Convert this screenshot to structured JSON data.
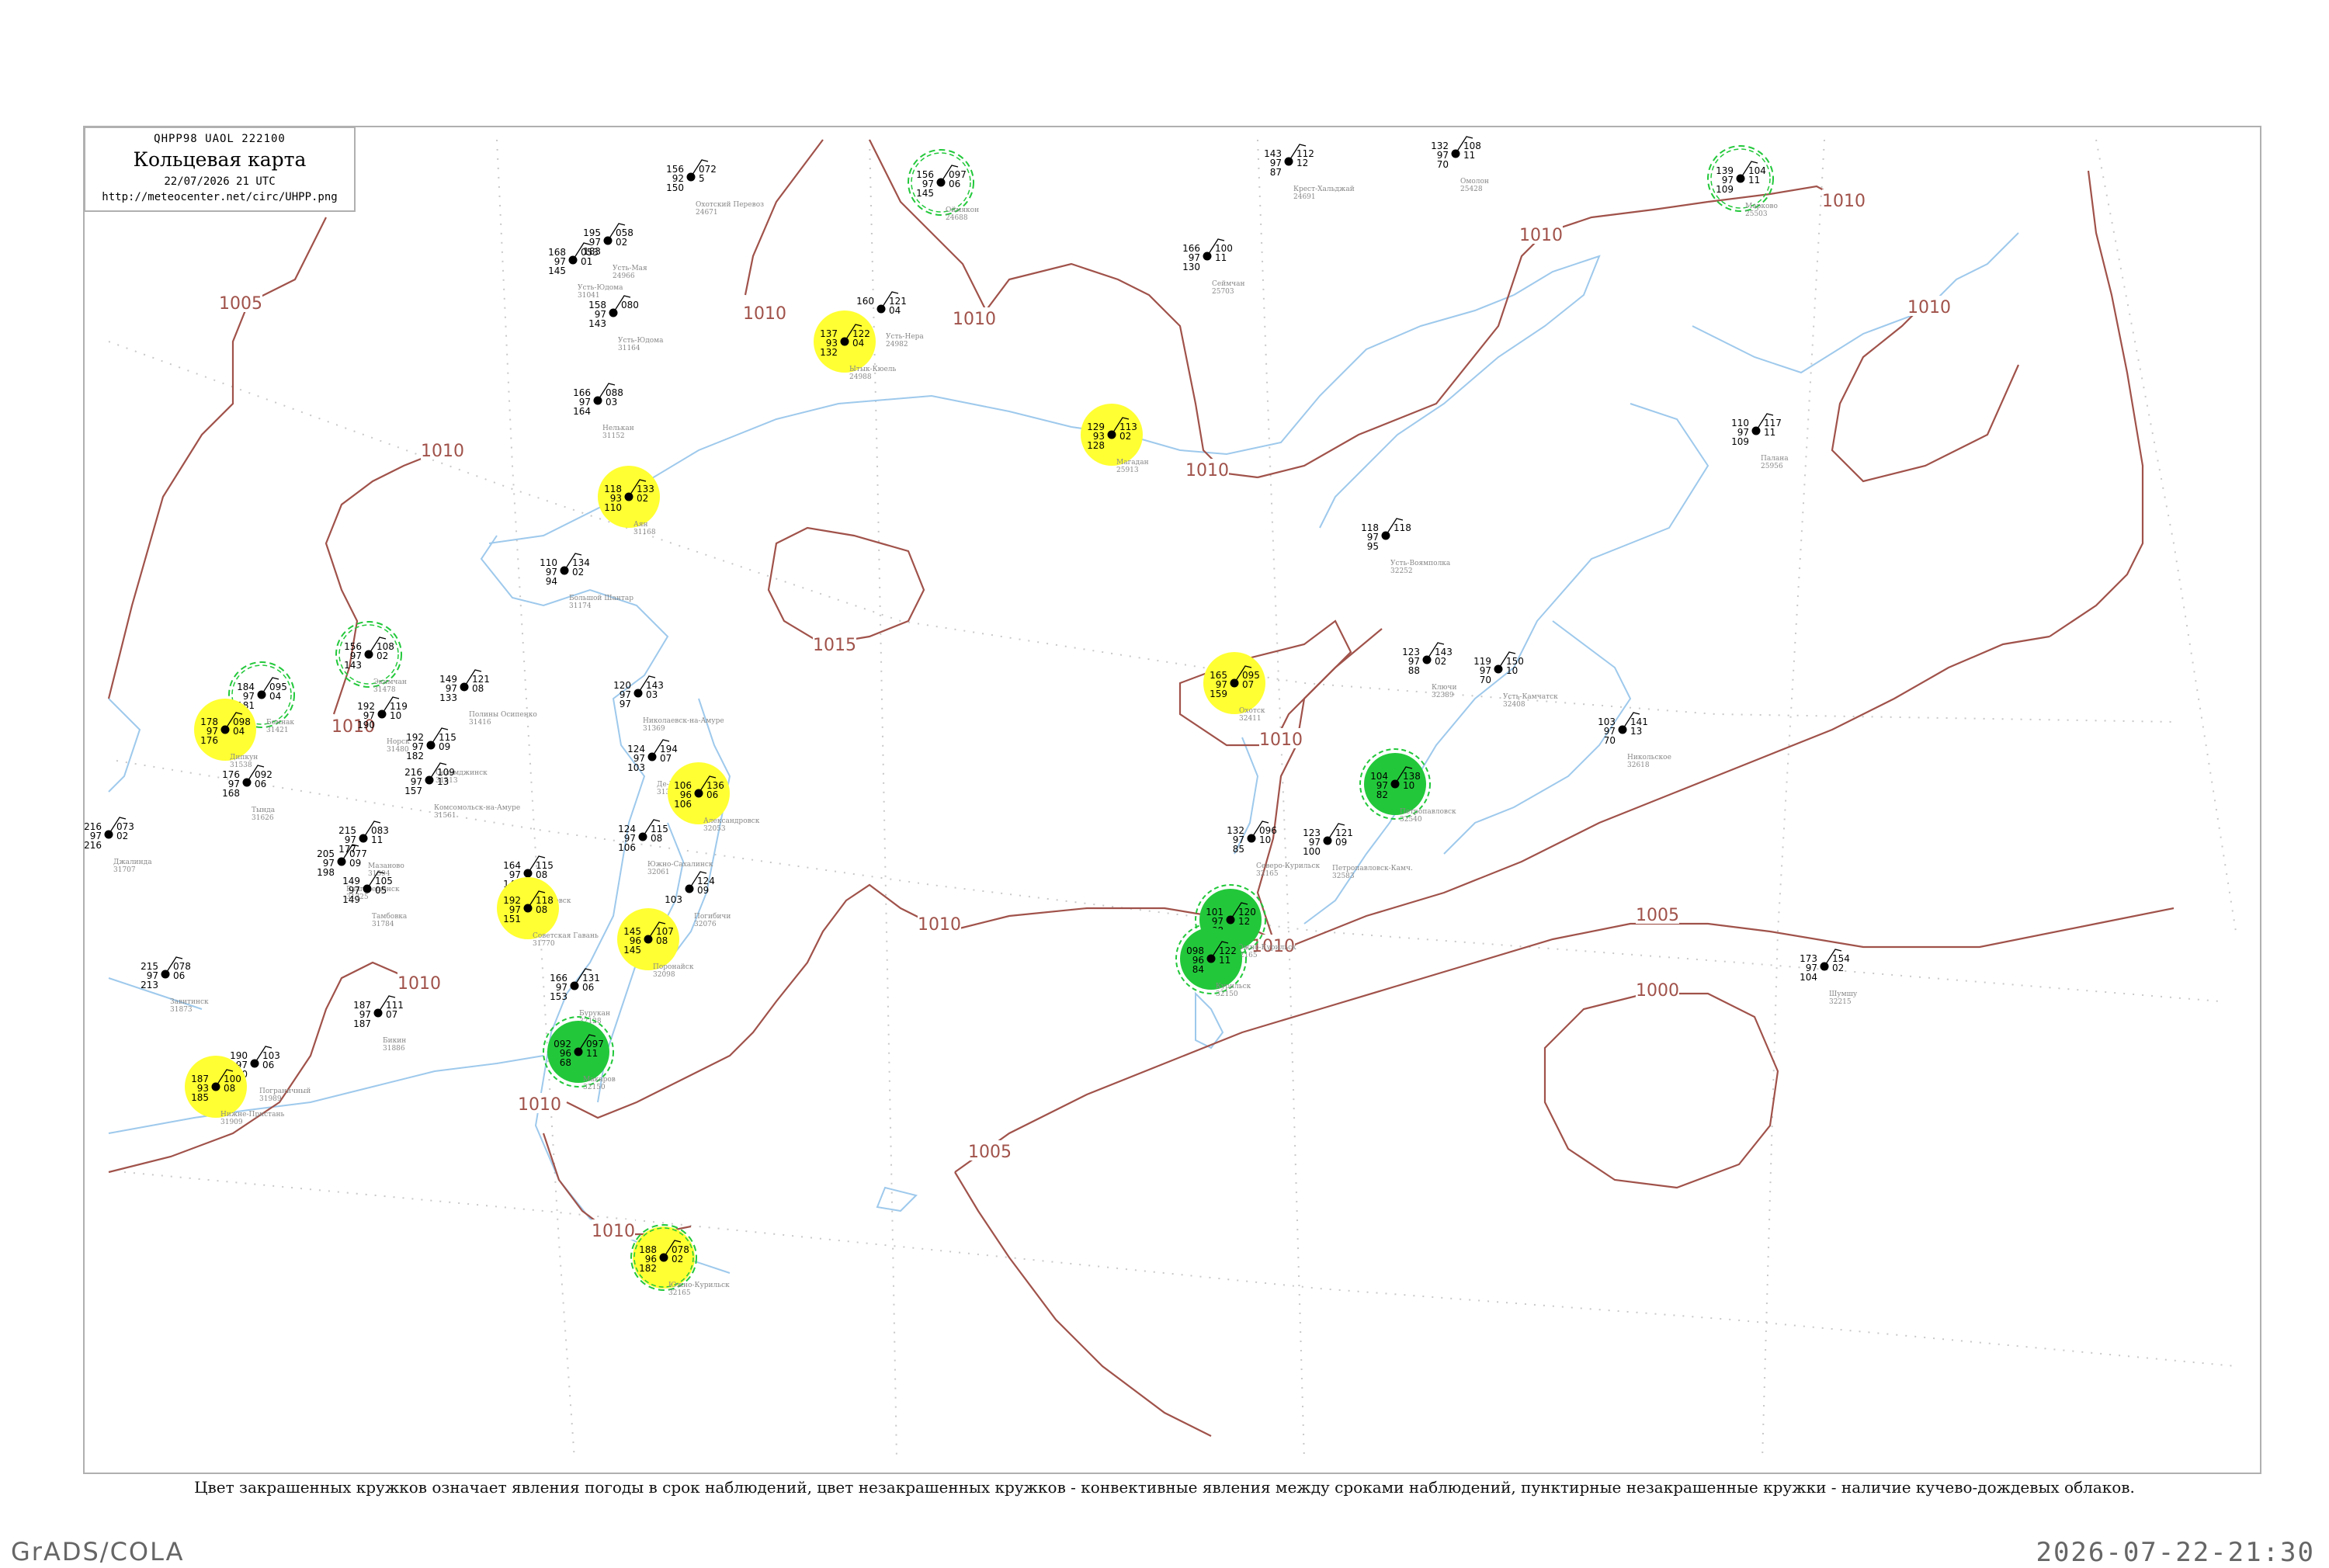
{
  "header": {
    "code_line": "QHPP98  UAOL  222100",
    "title": "Кольцевая карта",
    "time": "22/07/2026 21 UTC",
    "url": "http://meteocenter.net/circ/UHPP.png"
  },
  "caption": "Цвет закрашенных кружков означает явления погоды в срок наблюдений, цвет незакрашенных кружков - конвективные явления между сроками наблюдений, пунктирные незакрашенные кружки - наличие кучево-дождевых облаков.",
  "footer": {
    "left": "GrADS/COLA",
    "right": "2026-07-22-21:30"
  },
  "colors": {
    "isobar": "#a0524a",
    "coast": "#9ec9ec",
    "frame": "#b0b0b0",
    "grid": "#c8c8c8",
    "highlight_yellow": "#ffff33",
    "highlight_green": "#22c83a",
    "dashed_green": "#22c83a"
  },
  "isobar_labels": [
    {
      "text": "1005",
      "pos": [
        310,
        390
      ]
    },
    {
      "text": "1010",
      "pos": [
        570,
        580
      ]
    },
    {
      "text": "1010",
      "pos": [
        985,
        403
      ]
    },
    {
      "text": "1010",
      "pos": [
        1255,
        410
      ]
    },
    {
      "text": "1010",
      "pos": [
        1555,
        605
      ]
    },
    {
      "text": "1010",
      "pos": [
        1985,
        302
      ]
    },
    {
      "text": "1010",
      "pos": [
        2375,
        258
      ]
    },
    {
      "text": "1010",
      "pos": [
        2485,
        395
      ]
    },
    {
      "text": "1015",
      "pos": [
        1075,
        830
      ]
    },
    {
      "text": "1010",
      "pos": [
        1650,
        952
      ]
    },
    {
      "text": "1010",
      "pos": [
        1210,
        1190
      ]
    },
    {
      "text": "1010",
      "pos": [
        1640,
        1218
      ]
    },
    {
      "text": "1005",
      "pos": [
        2135,
        1178
      ]
    },
    {
      "text": "1000",
      "pos": [
        2135,
        1275
      ]
    },
    {
      "text": "1005",
      "pos": [
        1275,
        1483
      ]
    },
    {
      "text": "1010",
      "pos": [
        695,
        1422
      ]
    },
    {
      "text": "1010",
      "pos": [
        540,
        1266
      ]
    },
    {
      "text": "1010",
      "pos": [
        790,
        1585
      ]
    },
    {
      "text": "1010",
      "pos": [
        455,
        935
      ]
    }
  ],
  "stations": [
    {
      "t": "156",
      "td": "92",
      "p": "072",
      "v": "150",
      "n": "5",
      "id": "24671",
      "name": "Охотский Перевоз",
      "pos": [
        890,
        228
      ],
      "hl": "none"
    },
    {
      "t": "156",
      "td": "97",
      "p": "097",
      "v": "145",
      "n": "06",
      "id": "24688",
      "name": "Оймякон",
      "pos": [
        1212,
        235
      ],
      "hl": "dashed"
    },
    {
      "t": "143",
      "td": "97",
      "p": "112",
      "v": "87",
      "n": "12",
      "id": "24691",
      "name": "Крест-Хальджай",
      "pos": [
        1660,
        208
      ],
      "hl": "none"
    },
    {
      "t": "132",
      "td": "97",
      "p": "108",
      "v": "70",
      "n": "11",
      "id": "25428",
      "name": "Омолон",
      "pos": [
        1875,
        198
      ],
      "hl": "none"
    },
    {
      "t": "139",
      "td": "97",
      "p": "104",
      "v": "109",
      "n": "11",
      "id": "25503",
      "name": "Марково",
      "pos": [
        2242,
        230
      ],
      "hl": "dashed"
    },
    {
      "t": "168",
      "td": "97",
      "p": "053",
      "v": "145",
      "n": "01",
      "id": "31041",
      "name": "Усть-Юдома",
      "pos": [
        738,
        335
      ],
      "hl": "none"
    },
    {
      "t": "195",
      "td": "97",
      "p": "058",
      "v": "183",
      "n": "02",
      "id": "24966",
      "name": "Усть-Мая",
      "pos": [
        783,
        310
      ],
      "hl": "none"
    },
    {
      "t": "166",
      "td": "97",
      "p": "100",
      "v": "130",
      "n": "11",
      "id": "25703",
      "name": "Сеймчан",
      "pos": [
        1555,
        330
      ],
      "hl": "none"
    },
    {
      "t": "158",
      "td": "97",
      "p": "080",
      "v": "143",
      "n": "",
      "id": "31164",
      "name": "Усть-Юдома",
      "pos": [
        790,
        403
      ],
      "hl": "none"
    },
    {
      "t": "137",
      "td": "93",
      "p": "122",
      "v": "132",
      "n": "04",
      "id": "24988",
      "name": "Ытык-Кюель",
      "pos": [
        1088,
        440
      ],
      "hl": "yellow"
    },
    {
      "t": "160",
      "td": "",
      "p": "121",
      "v": "",
      "n": "04",
      "id": "24982",
      "name": "Усть-Нера",
      "pos": [
        1135,
        398
      ],
      "hl": "none"
    },
    {
      "t": "166",
      "td": "97",
      "p": "088",
      "v": "164",
      "n": "03",
      "id": "31152",
      "name": "Нелькан",
      "pos": [
        770,
        516
      ],
      "hl": "none"
    },
    {
      "t": "129",
      "td": "93",
      "p": "113",
      "v": "128",
      "n": "02",
      "id": "25913",
      "name": "Магадан",
      "pos": [
        1432,
        560
      ],
      "hl": "yellow"
    },
    {
      "t": "110",
      "td": "97",
      "p": "117",
      "v": "109",
      "n": "11",
      "id": "25956",
      "name": "Палана",
      "pos": [
        2262,
        555
      ],
      "hl": "none"
    },
    {
      "t": "118",
      "td": "93",
      "p": "133",
      "v": "110",
      "n": "02",
      "id": "31168",
      "name": "Аян",
      "pos": [
        810,
        640
      ],
      "hl": "yellow"
    },
    {
      "t": "110",
      "td": "97",
      "p": "134",
      "v": "94",
      "n": "02",
      "id": "31174",
      "name": "Большой Шантар",
      "pos": [
        727,
        735
      ],
      "hl": "none"
    },
    {
      "t": "118",
      "td": "97",
      "p": "118",
      "v": "95",
      "n": "",
      "id": "32252",
      "name": "Усть-Воямполка",
      "pos": [
        1785,
        690
      ],
      "hl": "none"
    },
    {
      "t": "156",
      "td": "97",
      "p": "108",
      "v": "143",
      "n": "02",
      "id": "31478",
      "name": "Экимчан",
      "pos": [
        475,
        843
      ],
      "hl": "dashed"
    },
    {
      "t": "184",
      "td": "97",
      "p": "095",
      "v": "181",
      "n": "04",
      "id": "31421",
      "name": "Бомнак",
      "pos": [
        337,
        895
      ],
      "hl": "dashed"
    },
    {
      "t": "149",
      "td": "97",
      "p": "121",
      "v": "133",
      "n": "08",
      "id": "31416",
      "name": "Полины Осипенко",
      "pos": [
        598,
        885
      ],
      "hl": "none"
    },
    {
      "t": "120",
      "td": "97",
      "p": "143",
      "v": "97",
      "n": "03",
      "id": "31369",
      "name": "Николаевск-на-Амуре",
      "pos": [
        822,
        893
      ],
      "hl": "none"
    },
    {
      "t": "123",
      "td": "97",
      "p": "143",
      "v": "88",
      "n": "02",
      "id": "32389",
      "name": "Ключи",
      "pos": [
        1838,
        850
      ],
      "hl": "none"
    },
    {
      "t": "119",
      "td": "97",
      "p": "150",
      "v": "70",
      "n": "10",
      "id": "32408",
      "name": "Усть-Камчатск",
      "pos": [
        1930,
        862
      ],
      "hl": "none"
    },
    {
      "t": "165",
      "td": "97",
      "p": "095",
      "v": "159",
      "n": "07",
      "id": "32411",
      "name": "Охотск",
      "pos": [
        1590,
        880
      ],
      "hl": "yellow"
    },
    {
      "t": "192",
      "td": "97",
      "p": "119",
      "v": "190",
      "n": "10",
      "id": "31480",
      "name": "Норск",
      "pos": [
        492,
        920
      ],
      "hl": "none"
    },
    {
      "t": "178",
      "td": "97",
      "p": "098",
      "v": "176",
      "n": "04",
      "id": "31538",
      "name": "Дипкун",
      "pos": [
        290,
        940
      ],
      "hl": "yellow"
    },
    {
      "t": "192",
      "td": "97",
      "p": "115",
      "v": "182",
      "n": "09",
      "id": "31513",
      "name": "Селемджинск",
      "pos": [
        555,
        960
      ],
      "hl": "none"
    },
    {
      "t": "124",
      "td": "97",
      "p": "194",
      "v": "103",
      "n": "07",
      "id": "31374",
      "name": "Де-Кастри",
      "pos": [
        840,
        975
      ],
      "hl": "none"
    },
    {
      "t": "103",
      "td": "97",
      "p": "141",
      "v": "70",
      "n": "13",
      "id": "32618",
      "name": "Никольское",
      "pos": [
        2090,
        940
      ],
      "hl": "none"
    },
    {
      "t": "176",
      "td": "97",
      "p": "092",
      "v": "168",
      "n": "06",
      "id": "31626",
      "name": "Тында",
      "pos": [
        318,
        1008
      ],
      "hl": "none"
    },
    {
      "t": "216",
      "td": "97",
      "p": "109",
      "v": "157",
      "n": "13",
      "id": "31561",
      "name": "Комсомольск-на-Амуре",
      "pos": [
        553,
        1005
      ],
      "hl": "none"
    },
    {
      "t": "106",
      "td": "96",
      "p": "136",
      "v": "106",
      "n": "06",
      "id": "32053",
      "name": "Александровск",
      "pos": [
        900,
        1022
      ],
      "hl": "yellow"
    },
    {
      "t": "104",
      "td": "97",
      "p": "138",
      "v": "82",
      "n": "10",
      "id": "32540",
      "name": "Петропавловск",
      "pos": [
        1797,
        1010
      ],
      "hl": "green"
    },
    {
      "t": "216",
      "td": "97",
      "p": "073",
      "v": "216",
      "n": "02",
      "id": "31707",
      "name": "Джалинда",
      "pos": [
        140,
        1075
      ],
      "hl": "none"
    },
    {
      "t": "215",
      "td": "97",
      "p": "083",
      "v": "177",
      "n": "11",
      "id": "31594",
      "name": "Мазаново",
      "pos": [
        468,
        1080
      ],
      "hl": "none"
    },
    {
      "t": "124",
      "td": "97",
      "p": "115",
      "v": "106",
      "n": "08",
      "id": "32061",
      "name": "Южно-Сахалинск",
      "pos": [
        828,
        1078
      ],
      "hl": "none"
    },
    {
      "t": "132",
      "td": "97",
      "p": "096",
      "v": "85",
      "n": "10",
      "id": "32165",
      "name": "Северо-Курильск",
      "pos": [
        1612,
        1080
      ],
      "hl": "none"
    },
    {
      "t": "123",
      "td": "97",
      "p": "121",
      "v": "100",
      "n": "09",
      "id": "32583",
      "name": "Петропавловск-Камч.",
      "pos": [
        1710,
        1083
      ],
      "hl": "none"
    },
    {
      "t": "205",
      "td": "97",
      "p": "077",
      "v": "198",
      "n": "09",
      "id": "31725",
      "name": "Благовещенск",
      "pos": [
        440,
        1110
      ],
      "hl": "none"
    },
    {
      "t": "164",
      "td": "97",
      "p": "115",
      "v": "149",
      "n": "08",
      "id": "31735",
      "name": "Хабаровск",
      "pos": [
        680,
        1125
      ],
      "hl": "none"
    },
    {
      "t": "",
      "td": "",
      "p": "124",
      "v": "103",
      "n": "09",
      "id": "32076",
      "name": "Погибичи",
      "pos": [
        888,
        1145
      ],
      "hl": "none"
    },
    {
      "t": "149",
      "td": "97",
      "p": "105",
      "v": "149",
      "n": "05",
      "id": "31784",
      "name": "Тамбовка",
      "pos": [
        473,
        1145
      ],
      "hl": "none"
    },
    {
      "t": "192",
      "td": "97",
      "p": "118",
      "v": "151",
      "n": "08",
      "id": "31770",
      "name": "Советская Гавань",
      "pos": [
        680,
        1170
      ],
      "hl": "yellow"
    },
    {
      "t": "145",
      "td": "96",
      "p": "107",
      "v": "145",
      "n": "08",
      "id": "32098",
      "name": "Поронайск",
      "pos": [
        835,
        1210
      ],
      "hl": "yellow"
    },
    {
      "t": "215",
      "td": "97",
      "p": "078",
      "v": "213",
      "n": "06",
      "id": "31873",
      "name": "Завитинск",
      "pos": [
        213,
        1255
      ],
      "hl": "none"
    },
    {
      "t": "166",
      "td": "97",
      "p": "131",
      "v": "153",
      "n": "06",
      "id": "32128",
      "name": "Бурукан",
      "pos": [
        740,
        1270
      ],
      "hl": "none"
    },
    {
      "t": "187",
      "td": "97",
      "p": "111",
      "v": "187",
      "n": "07",
      "id": "31886",
      "name": "Бикин",
      "pos": [
        487,
        1305
      ],
      "hl": "none"
    },
    {
      "t": "101",
      "td": "97",
      "p": "120",
      "v": "88",
      "n": "12",
      "id": "32165",
      "name": "Южно-Курильск",
      "pos": [
        1585,
        1185
      ],
      "hl": "green"
    },
    {
      "t": "098",
      "td": "96",
      "p": "122",
      "v": "84",
      "n": "11",
      "id": "32150",
      "name": "Курильск",
      "pos": [
        1560,
        1235
      ],
      "hl": "green"
    },
    {
      "t": "173",
      "td": "97",
      "p": "154",
      "v": "104",
      "n": "02",
      "id": "32215",
      "name": "Шумшу",
      "pos": [
        2350,
        1245
      ],
      "hl": "none"
    },
    {
      "t": "190",
      "td": "97",
      "p": "103",
      "v": "130",
      "n": "06",
      "id": "31989",
      "name": "Пограничный",
      "pos": [
        328,
        1370
      ],
      "hl": "none"
    },
    {
      "t": "187",
      "td": "93",
      "p": "100",
      "v": "185",
      "n": "08",
      "id": "31909",
      "name": "Нижне-Пристань",
      "pos": [
        278,
        1400
      ],
      "hl": "yellow"
    },
    {
      "t": "092",
      "td": "96",
      "p": "097",
      "v": "68",
      "n": "11",
      "id": "32150",
      "name": "Макаров",
      "pos": [
        745,
        1355
      ],
      "hl": "green"
    },
    {
      "t": "188",
      "td": "96",
      "p": "078",
      "v": "182",
      "n": "02",
      "id": "32165",
      "name": "Южно-Курильск",
      "pos": [
        855,
        1620
      ],
      "hl": "yellow-dashed"
    }
  ],
  "axes": {
    "grid": "on"
  }
}
